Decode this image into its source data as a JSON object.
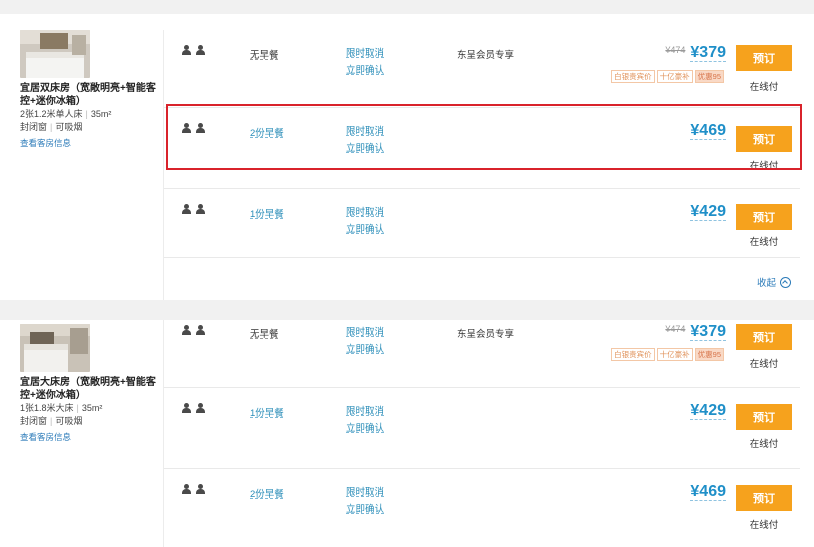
{
  "rooms": [
    {
      "name": "宜居双床房（宽敞明亮+智能客控+迷你冰箱）",
      "bed": "2张1.2米单人床",
      "area": "35m²",
      "window": "封闭窗",
      "smoking": "可吸烟",
      "details_link": "查看客房信息",
      "rates": [
        {
          "breakfast": "无早餐",
          "cancel": "限时取消",
          "confirm": "立即确认",
          "promo": "东呈会员专享",
          "orig_price": "¥474",
          "price": "¥379",
          "tags": [
            "白银贵宾价",
            "十亿豪补",
            "优惠95"
          ],
          "book": "预订",
          "pay": "在线付"
        },
        {
          "breakfast": "2份早餐",
          "cancel": "限时取消",
          "confirm": "立即确认",
          "promo": "",
          "orig_price": "",
          "price": "¥469",
          "tags": [],
          "book": "预订",
          "pay": "在线付"
        },
        {
          "breakfast": "1份早餐",
          "cancel": "限时取消",
          "confirm": "立即确认",
          "promo": "",
          "orig_price": "",
          "price": "¥429",
          "tags": [],
          "book": "预订",
          "pay": "在线付"
        }
      ],
      "collapse_label": "收起"
    },
    {
      "name": "宜居大床房（宽敞明亮+智能客控+迷你冰箱）",
      "bed": "1张1.8米大床",
      "area": "35m²",
      "window": "封闭窗",
      "smoking": "可吸烟",
      "details_link": "查看客房信息",
      "rates": [
        {
          "breakfast": "无早餐",
          "cancel": "限时取消",
          "confirm": "立即确认",
          "promo": "东呈会员专享",
          "orig_price": "¥474",
          "price": "¥379",
          "tags": [
            "白银贵宾价",
            "十亿豪补",
            "优惠95"
          ],
          "book": "预订",
          "pay": "在线付"
        },
        {
          "breakfast": "1份早餐",
          "cancel": "限时取消",
          "confirm": "立即确认",
          "promo": "",
          "orig_price": "",
          "price": "¥429",
          "tags": [],
          "book": "预订",
          "pay": "在线付"
        },
        {
          "breakfast": "2份早餐",
          "cancel": "限时取消",
          "confirm": "立即确认",
          "promo": "",
          "orig_price": "",
          "price": "¥469",
          "tags": [],
          "book": "预订",
          "pay": "在线付"
        }
      ]
    }
  ],
  "colors": {
    "accent": "#f6a21d",
    "price": "#1f8fc8",
    "link": "#2a8db8",
    "highlight": "#d9232b"
  }
}
